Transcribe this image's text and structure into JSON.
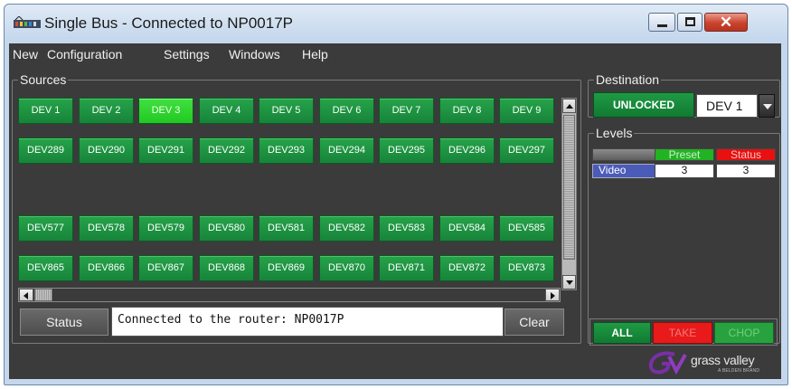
{
  "window": {
    "title": "Single Bus - Connected to NP0017P",
    "icon": "router-app-icon",
    "controls": {
      "minimize": "minimize-icon",
      "maximize": "maximize-icon",
      "close": "✕"
    }
  },
  "menu": [
    "New",
    "Configuration",
    "Settings",
    "Windows",
    "Help"
  ],
  "sources": {
    "label": "Sources",
    "selected": "DEV 3",
    "rows": [
      [
        "DEV 1",
        "DEV 2",
        "DEV 3",
        "DEV 4",
        "DEV 5",
        "DEV 6",
        "DEV 7",
        "DEV 8",
        "DEV 9"
      ],
      [
        "DEV289",
        "DEV290",
        "DEV291",
        "DEV292",
        "DEV293",
        "DEV294",
        "DEV295",
        "DEV296",
        "DEV297"
      ],
      [
        "DEV577",
        "DEV578",
        "DEV579",
        "DEV580",
        "DEV581",
        "DEV582",
        "DEV583",
        "DEV584",
        "DEV585"
      ],
      [
        "DEV865",
        "DEV866",
        "DEV867",
        "DEV868",
        "DEV869",
        "DEV870",
        "DEV871",
        "DEV872",
        "DEV873"
      ]
    ]
  },
  "status_bar": {
    "status_label": "Status",
    "message": "Connected to the router: NP0017P",
    "clear_label": "Clear"
  },
  "destination": {
    "label": "Destination",
    "lock_label": "UNLOCKED",
    "selected": "DEV 1"
  },
  "levels": {
    "label": "Levels",
    "preset_label": "Preset",
    "status_label": "Status",
    "rows": [
      {
        "name": "Video",
        "preset": "3",
        "status": "3"
      }
    ]
  },
  "commands": {
    "all": "ALL",
    "take": "TAKE",
    "chop": "CHOP"
  },
  "brand": {
    "name": "grass valley",
    "sub": "A BELDEN BRAND"
  },
  "colors": {
    "source_button": "#1e9440",
    "selected_source": "#33d633",
    "preset": "#22b322",
    "status": "#e81010",
    "take": "#e81a1a"
  }
}
